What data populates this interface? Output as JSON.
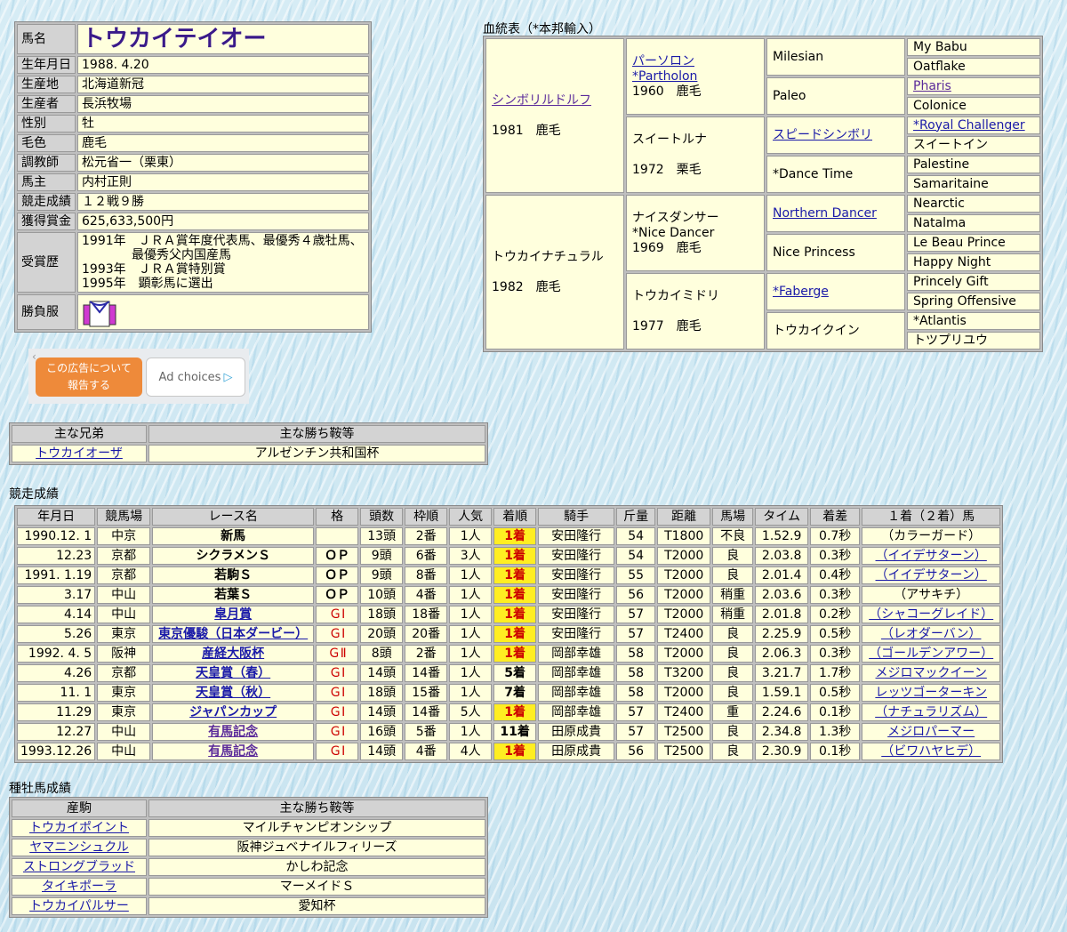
{
  "profile": {
    "rows": [
      {
        "label": "馬名",
        "value": "トウカイテイオー"
      },
      {
        "label": "生年月日",
        "value": "1988. 4.20"
      },
      {
        "label": "生産地",
        "value": "北海道新冠"
      },
      {
        "label": "生産者",
        "value": "長浜牧場"
      },
      {
        "label": "性別",
        "value": "牡"
      },
      {
        "label": "毛色",
        "value": "鹿毛"
      },
      {
        "label": "調教師",
        "value": "松元省一（栗東）"
      },
      {
        "label": "馬主",
        "value": "内村正則"
      },
      {
        "label": "競走成績",
        "value": "１２戦９勝"
      },
      {
        "label": "獲得賞金",
        "value": "625,633,500円"
      }
    ],
    "awards_label": "受賞歴",
    "awards": [
      "1991年　ＪＲＡ賞年度代表馬、最優秀４歳牡馬、",
      "　　　　最優秀父内国産馬",
      "1993年　ＪＲＡ賞特別賞",
      "1995年　顕彰馬に選出"
    ],
    "silks_label": "勝負服"
  },
  "pedigree": {
    "title": "血統表（*本邦輸入）",
    "sire": {
      "name": "シンボリルドルフ",
      "info": "1981　鹿毛"
    },
    "dam": {
      "name": "トウカイナチュラル",
      "info": "1982　鹿毛"
    },
    "ss": {
      "name": "パーソロン",
      "name2": "*Partholon",
      "info": "1960　鹿毛"
    },
    "sd": {
      "name": "スイートルナ",
      "info": "1972　栗毛"
    },
    "ds": {
      "name": "ナイスダンサー",
      "name2": "*Nice Dancer",
      "info": "1969　鹿毛"
    },
    "dd": {
      "name": "トウカイミドリ",
      "info": "1977　鹿毛"
    },
    "g3": [
      "Milesian",
      "Paleo",
      "スピードシンボリ",
      "*Dance Time",
      "Northern Dancer",
      "Nice Princess",
      "*Faberge",
      "トウカイクイン"
    ],
    "g4": [
      "My Babu",
      "Oatflake",
      "Pharis",
      "Colonice",
      "*Royal Challenger",
      "スイートイン",
      "Palestine",
      "Samaritaine",
      "Nearctic",
      "Natalma",
      "Le Beau Prince",
      "Happy Night",
      "Princely Gift",
      "Spring Offensive",
      "*Atlantis",
      "トツプリユウ"
    ]
  },
  "ad": {
    "report": "この広告について報告する",
    "choices": "Ad choices"
  },
  "siblings": {
    "headers": [
      "主な兄弟",
      "主な勝ち鞍等"
    ],
    "rows": [
      [
        "トウカイオーザ",
        "アルゼンチン共和国杯"
      ]
    ]
  },
  "races": {
    "title": "競走成績",
    "headers": [
      "年月日",
      "競馬場",
      "レース名",
      "格",
      "頭数",
      "枠順",
      "人気",
      "着順",
      "騎手",
      "斤量",
      "距離",
      "馬場",
      "タイム",
      "着差",
      "１着（２着）馬"
    ],
    "rows": [
      [
        "1990.12. 1",
        "中京",
        "新馬",
        "",
        "13頭",
        "2番",
        "1人",
        "1着",
        "安田隆行",
        "54",
        "T1800",
        "不良",
        "1.52.9",
        "0.7秒",
        "（カラーガード）"
      ],
      [
        "12.23",
        "京都",
        "シクラメンＳ",
        "ＯＰ",
        "9頭",
        "6番",
        "3人",
        "1着",
        "安田隆行",
        "54",
        "T2000",
        "良",
        "2.03.8",
        "0.3秒",
        "（イイデサターン）"
      ],
      [
        "1991. 1.19",
        "京都",
        "若駒Ｓ",
        "ＯＰ",
        "9頭",
        "8番",
        "1人",
        "1着",
        "安田隆行",
        "55",
        "T2000",
        "良",
        "2.01.4",
        "0.4秒",
        "（イイデサターン）"
      ],
      [
        "3.17",
        "中山",
        "若葉Ｓ",
        "ＯＰ",
        "10頭",
        "4番",
        "1人",
        "1着",
        "安田隆行",
        "56",
        "T2000",
        "稍重",
        "2.03.6",
        "0.3秒",
        "（アサキチ）"
      ],
      [
        "4.14",
        "中山",
        "皐月賞",
        "ＧⅠ",
        "18頭",
        "18番",
        "1人",
        "1着",
        "安田隆行",
        "57",
        "T2000",
        "稍重",
        "2.01.8",
        "0.2秒",
        "（シャコーグレイド）"
      ],
      [
        "5.26",
        "東京",
        "東京優駿（日本ダービー）",
        "ＧⅠ",
        "20頭",
        "20番",
        "1人",
        "1着",
        "安田隆行",
        "57",
        "T2400",
        "良",
        "2.25.9",
        "0.5秒",
        "（レオダーバン）"
      ],
      [
        "1992. 4. 5",
        "阪神",
        "産経大阪杯",
        "ＧⅡ",
        "8頭",
        "2番",
        "1人",
        "1着",
        "岡部幸雄",
        "58",
        "T2000",
        "良",
        "2.06.3",
        "0.3秒",
        "（ゴールデンアワー）"
      ],
      [
        "4.26",
        "京都",
        "天皇賞（春）",
        "ＧⅠ",
        "14頭",
        "14番",
        "1人",
        "5着",
        "岡部幸雄",
        "58",
        "T3200",
        "良",
        "3.21.7",
        "1.7秒",
        "メジロマックイーン"
      ],
      [
        "11. 1",
        "東京",
        "天皇賞（秋）",
        "ＧⅠ",
        "18頭",
        "15番",
        "1人",
        "7着",
        "岡部幸雄",
        "58",
        "T2000",
        "良",
        "1.59.1",
        "0.5秒",
        "レッツゴーターキン"
      ],
      [
        "11.29",
        "東京",
        "ジャパンカップ",
        "ＧⅠ",
        "14頭",
        "14番",
        "5人",
        "1着",
        "岡部幸雄",
        "57",
        "T2400",
        "重",
        "2.24.6",
        "0.1秒",
        "（ナチュラリズム）"
      ],
      [
        "12.27",
        "中山",
        "有馬記念",
        "ＧⅠ",
        "16頭",
        "5番",
        "1人",
        "11着",
        "田原成貴",
        "57",
        "T2500",
        "良",
        "2.34.8",
        "1.3秒",
        "メジロパーマー"
      ],
      [
        "1993.12.26",
        "中山",
        "有馬記念",
        "ＧⅠ",
        "14頭",
        "4番",
        "4人",
        "1着",
        "田原成貴",
        "56",
        "T2500",
        "良",
        "2.30.9",
        "0.1秒",
        "（ビワハヤヒデ）"
      ]
    ]
  },
  "stud": {
    "title": "種牡馬成績",
    "headers": [
      "産駒",
      "主な勝ち鞍等"
    ],
    "rows": [
      [
        "トウカイポイント",
        "マイルチャンピオンシップ"
      ],
      [
        "ヤマニンシュクル",
        "阪神ジュベナイルフィリーズ"
      ],
      [
        "ストロングブラッド",
        "かしわ記念"
      ],
      [
        "タイキポーラ",
        "マーメイドＳ"
      ],
      [
        "トウカイパルサー",
        "愛知杯"
      ]
    ]
  }
}
